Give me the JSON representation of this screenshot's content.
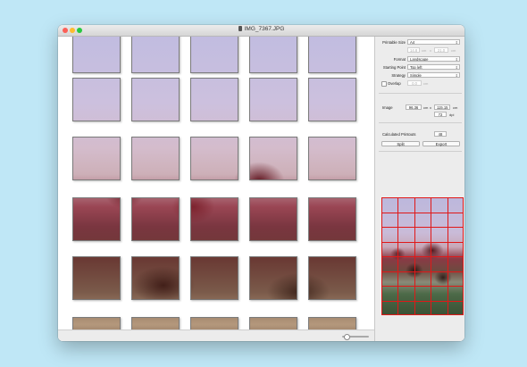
{
  "window": {
    "title": "IMG_7367.JPG"
  },
  "settings": {
    "printable_size_label": "Printable Size",
    "printable_size_value": "A4",
    "width_value": "14.8",
    "width_unit": "cm",
    "times": "x",
    "height_value": "21.0",
    "height_unit": "cm",
    "format_label": "Format",
    "format_value": "Landscape",
    "starting_point_label": "Starting Point",
    "starting_point_value": "Top left",
    "strategy_label": "Strategy",
    "strategy_value": "Simple",
    "overlap_label": "Overlap",
    "overlap_value": "0.0",
    "overlap_unit": "cm"
  },
  "image": {
    "label": "Image",
    "width_value": "96.36",
    "width_unit": "cm",
    "times": "x",
    "height_value": "115.15",
    "height_unit": "cm",
    "dpi_value": "72",
    "dpi_unit": "dpi"
  },
  "printouts": {
    "label": "Calculated Printouts",
    "value": "48"
  },
  "buttons": {
    "split": "Split",
    "export": "Export"
  },
  "icons": [
    "close-icon",
    "minimize-icon",
    "maximize-icon",
    "document-icon",
    "zoom-slider"
  ],
  "colors": {
    "grid_red": "#e01818",
    "background": "#bfe7f6"
  }
}
